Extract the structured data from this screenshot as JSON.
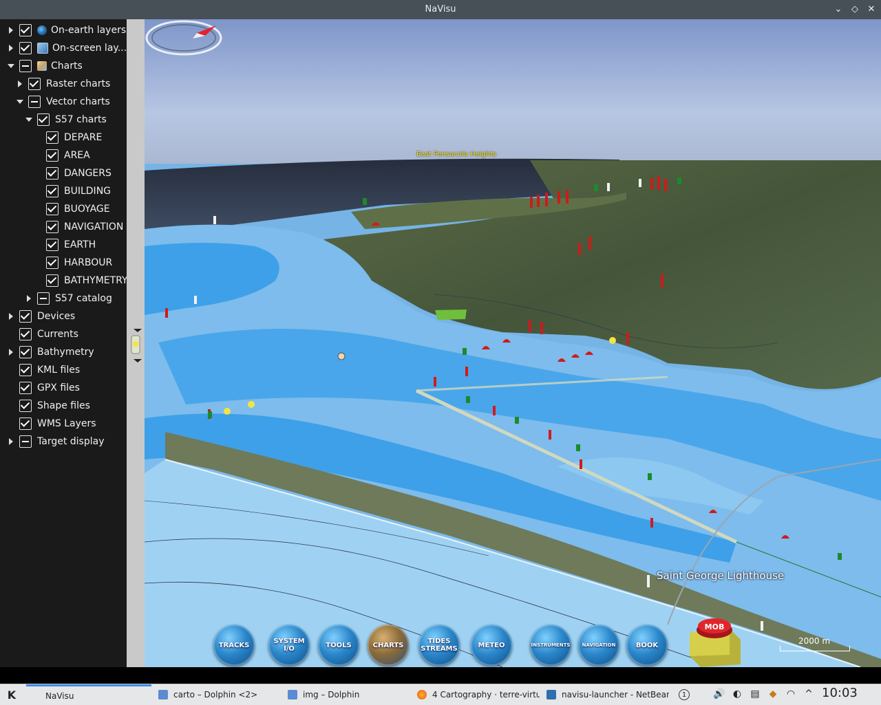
{
  "window": {
    "title": "NaVisu",
    "buttons": {
      "minimize": "⌄",
      "restore": "◇",
      "close": "✕"
    }
  },
  "layers": [
    {
      "label": "On-earth layers",
      "icon": "earth-icon",
      "expander": "right",
      "check": "checked"
    },
    {
      "label": "On-screen lay...",
      "icon": "screen-icon",
      "expander": "right",
      "check": "checked"
    },
    {
      "label": "Charts",
      "icon": "charts-icon",
      "expander": "down",
      "check": "partial"
    },
    {
      "label": "Raster charts",
      "expander": "right",
      "check": "checked"
    },
    {
      "label": "Vector charts",
      "expander": "down",
      "check": "partial"
    },
    {
      "label": "S57 charts",
      "expander": "down",
      "check": "checked"
    },
    {
      "label": "DEPARE",
      "expander": "none",
      "check": "checked"
    },
    {
      "label": "AREA",
      "expander": "none",
      "check": "checked"
    },
    {
      "label": "DANGERS",
      "expander": "none",
      "check": "checked"
    },
    {
      "label": "BUILDING",
      "expander": "none",
      "check": "checked"
    },
    {
      "label": "BUOYAGE",
      "expander": "none",
      "check": "checked"
    },
    {
      "label": "NAVIGATION",
      "expander": "none",
      "check": "checked"
    },
    {
      "label": "EARTH",
      "expander": "none",
      "check": "checked"
    },
    {
      "label": "HARBOUR",
      "expander": "none",
      "check": "checked"
    },
    {
      "label": "BATHYMETRY",
      "expander": "none",
      "check": "checked"
    },
    {
      "label": "S57 catalog",
      "expander": "right",
      "check": "partial"
    },
    {
      "label": "Devices",
      "expander": "right",
      "check": "checked"
    },
    {
      "label": "Currents",
      "expander": "none",
      "check": "checked"
    },
    {
      "label": "Bathymetry",
      "expander": "right",
      "check": "checked"
    },
    {
      "label": "KML files",
      "expander": "none",
      "check": "checked"
    },
    {
      "label": "GPX files",
      "expander": "none",
      "check": "checked"
    },
    {
      "label": "Shape files",
      "expander": "none",
      "check": "checked"
    },
    {
      "label": "WMS Layers",
      "expander": "none",
      "check": "checked"
    },
    {
      "label": "Target display",
      "expander": "right",
      "check": "partial"
    }
  ],
  "map": {
    "place_label": "East Pensacola Heights",
    "lighthouse_label": "Saint George Lighthouse",
    "scale": "2000 m",
    "colors": {
      "deep_water": "#3ea0e8",
      "shallow_water": "#8cc8f0",
      "land": "#4e5e3f",
      "sky": "#95aed8"
    }
  },
  "toolbar": {
    "tracks": "TRACKS",
    "system_io": [
      "SYSTEM",
      "I/O"
    ],
    "tools": "TOOLS",
    "charts": "CHARTS",
    "tides": [
      "TIDES",
      "STREAMS"
    ],
    "meteo": "METEO",
    "instruments": "INSTRUMENTS",
    "navigation": "NAVIGATION",
    "book": "BOOK",
    "mob": "MOB"
  },
  "taskbar": {
    "start_icon": "K",
    "tasks": [
      {
        "label": "NaVisu",
        "active": true
      },
      {
        "label": "carto – Dolphin <2>"
      },
      {
        "label": "img – Dolphin"
      },
      {
        "label": "4 Cartography · terre-virtu"
      },
      {
        "label": "navisu-launcher - NetBean"
      }
    ],
    "tray_count": "1",
    "clock": "10:03"
  }
}
